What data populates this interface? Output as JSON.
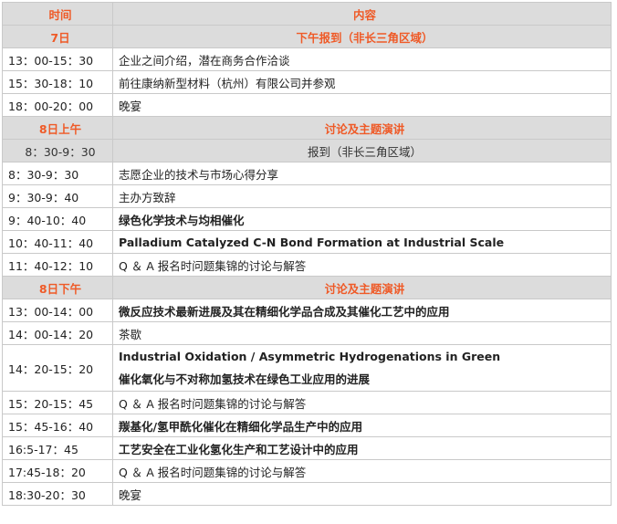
{
  "header": {
    "time_col": "时间",
    "content_col": "内容"
  },
  "rows": [
    {
      "kind": "section",
      "time": "7日",
      "content": "下午报到（非长三角区域）"
    },
    {
      "kind": "normal",
      "time": "13：00-15：30",
      "content": "企业之间介绍，潜在商务合作洽谈"
    },
    {
      "kind": "normal",
      "time": "15：30-18：10",
      "content": "前往康纳新型材料（杭州）有限公司并参观"
    },
    {
      "kind": "normal",
      "time": "18：00-20：00",
      "content": "晚宴"
    },
    {
      "kind": "section",
      "time": "8日上午",
      "content": "讨论及主题演讲"
    },
    {
      "kind": "subhead",
      "time": "8：30-9：30",
      "content": "报到（非长三角区域）"
    },
    {
      "kind": "normal",
      "time": "8：30-9：30",
      "content": "志愿企业的技术与市场心得分享"
    },
    {
      "kind": "normal",
      "time": "9：30-9：40",
      "content": "主办方致辞"
    },
    {
      "kind": "bold",
      "time": "9：40-10：40",
      "content": "绿色化学技术与均相催化"
    },
    {
      "kind": "bold",
      "time": "10：40-11：40",
      "content": "Palladium Catalyzed C-N Bond Formation at Industrial Scale"
    },
    {
      "kind": "normal",
      "time": "11：40-12：10",
      "content": "Q ＆ A  报名时问题集锦的讨论与解答"
    },
    {
      "kind": "section",
      "time": "8日下午",
      "content": "讨论及主题演讲"
    },
    {
      "kind": "bold",
      "time": "13：00-14：00",
      "content": "微反应技术最新进展及其在精细化学品合成及其催化工艺中的应用"
    },
    {
      "kind": "normal",
      "time": "14：00-14：20",
      "content": "茶歇"
    },
    {
      "kind": "tall",
      "time": "14：20-15：20",
      "content_line1": "Industrial Oxidation / Asymmetric Hydrogenations in Green",
      "content_line2": "催化氧化与不对称加氢技术在绿色工业应用的进展"
    },
    {
      "kind": "normal",
      "time": "15：20-15：45",
      "content": "Q ＆ A  报名时问题集锦的讨论与解答"
    },
    {
      "kind": "bold",
      "time": "15：45-16：40",
      "content": "羰基化/氢甲酰化催化在精细化学品生产中的应用"
    },
    {
      "kind": "bold",
      "time": "16:5-17：45",
      "content": "工艺安全在工业化氢化生产和工艺设计中的应用"
    },
    {
      "kind": "normal",
      "time": "17:45-18：20",
      "content": "Q ＆ A  报名时问题集锦的讨论与解答"
    },
    {
      "kind": "normal",
      "time": "18:30-20：30",
      "content": "晚宴"
    }
  ],
  "colors": {
    "accent": "#ef5a27",
    "header_bg": "#dcdcdc",
    "border": "#c9c9c9"
  }
}
